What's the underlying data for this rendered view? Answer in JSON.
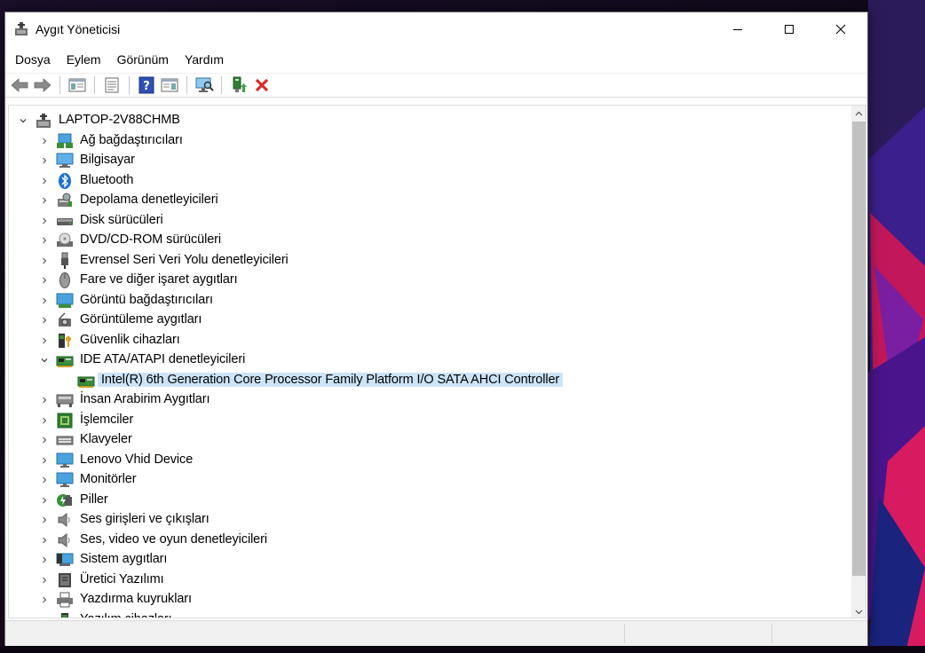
{
  "window": {
    "title": "Aygıt Yöneticisi",
    "controls": [
      "minimize",
      "maximize",
      "close"
    ]
  },
  "menubar": {
    "items": [
      "Dosya",
      "Eylem",
      "Görünüm",
      "Yardım"
    ]
  },
  "toolbar": {
    "buttons": [
      "back-icon",
      "forward-icon",
      "show-hide-console-tree-icon",
      "properties-icon",
      "help-icon",
      "action-pane-icon",
      "scan-hardware-icon",
      "update-driver-icon",
      "uninstall-device-icon"
    ]
  },
  "tree": {
    "root": "LAPTOP-2V88CHMB",
    "items": [
      {
        "label": "Ağ bağdaştırıcıları",
        "icon": "network-adapter-icon",
        "expanded": false
      },
      {
        "label": "Bilgisayar",
        "icon": "computer-icon",
        "expanded": false
      },
      {
        "label": "Bluetooth",
        "icon": "bluetooth-icon",
        "expanded": false
      },
      {
        "label": "Depolama denetleyicileri",
        "icon": "storage-controller-icon",
        "expanded": false
      },
      {
        "label": "Disk sürücüleri",
        "icon": "disk-drive-icon",
        "expanded": false
      },
      {
        "label": "DVD/CD-ROM sürücüleri",
        "icon": "dvd-icon",
        "expanded": false
      },
      {
        "label": "Evrensel Seri Veri Yolu denetleyicileri",
        "icon": "usb-icon",
        "expanded": false
      },
      {
        "label": "Fare ve diğer işaret aygıtları",
        "icon": "mouse-icon",
        "expanded": false
      },
      {
        "label": "Görüntü bağdaştırıcıları",
        "icon": "display-adapter-icon",
        "expanded": false
      },
      {
        "label": "Görüntüleme aygıtları",
        "icon": "imaging-device-icon",
        "expanded": false
      },
      {
        "label": "Güvenlik cihazları",
        "icon": "security-device-icon",
        "expanded": false
      },
      {
        "label": "IDE ATA/ATAPI denetleyicileri",
        "icon": "ide-controller-icon",
        "expanded": true
      },
      {
        "label": "Intel(R) 6th Generation Core Processor Family Platform I/O SATA AHCI Controller",
        "icon": "ide-controller-icon",
        "child": true,
        "selected": true
      },
      {
        "label": "İnsan Arabirim Aygıtları",
        "icon": "hid-icon",
        "expanded": false
      },
      {
        "label": "İşlemciler",
        "icon": "processor-icon",
        "expanded": false
      },
      {
        "label": "Klavyeler",
        "icon": "keyboard-icon",
        "expanded": false
      },
      {
        "label": "Lenovo Vhid Device",
        "icon": "monitor-icon",
        "expanded": false
      },
      {
        "label": "Monitörler",
        "icon": "monitor-icon",
        "expanded": false
      },
      {
        "label": "Piller",
        "icon": "battery-icon",
        "expanded": false
      },
      {
        "label": "Ses girişleri ve çıkışları",
        "icon": "audio-icon",
        "expanded": false
      },
      {
        "label": "Ses, video ve oyun denetleyicileri",
        "icon": "audio-icon",
        "expanded": false
      },
      {
        "label": "Sistem aygıtları",
        "icon": "system-device-icon",
        "expanded": false
      },
      {
        "label": "Üretici Yazılımı",
        "icon": "firmware-icon",
        "expanded": false
      },
      {
        "label": "Yazdırma kuyrukları",
        "icon": "printer-icon",
        "expanded": false
      },
      {
        "label": "Yazılım cihazları",
        "icon": "software-device-icon",
        "expanded": false
      }
    ]
  },
  "colors": {
    "selection": "#cce4f7",
    "window_bg": "#ffffff",
    "statusbar_bg": "#f0f0f0"
  }
}
